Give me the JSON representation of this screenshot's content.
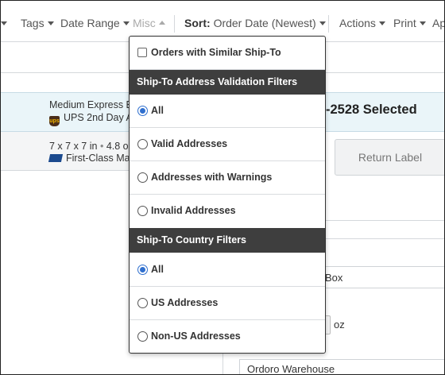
{
  "toolbar": {
    "tags_label": "Tags",
    "date_range_label": "Date Range",
    "misc_label": "Misc",
    "sort_label": "Sort:",
    "sort_value": "Order Date (Newest)",
    "actions_label": "Actions",
    "print_label": "Print",
    "partial_label": "Ap"
  },
  "background": {
    "row1_line1": "Medium Express B",
    "row1_line2": "UPS 2nd Day A",
    "row2_line1": "7 x 7 x 7 in",
    "row2_line1_weight": "4.8 oz",
    "row2_line2": "First-Class Ma",
    "selected_title": "-2528 Selected",
    "return_label_button": "Return Label",
    "box_value": "Box",
    "oz_label": "oz",
    "warehouse_value": "Ordoro Warehouse"
  },
  "dropdown": {
    "similar_shipto_label": "Orders with Similar Ship-To",
    "address_header": "Ship-To Address Validation Filters",
    "address_options": [
      {
        "label": "All",
        "checked": true
      },
      {
        "label": "Valid Addresses",
        "checked": false
      },
      {
        "label": "Addresses with Warnings",
        "checked": false
      },
      {
        "label": "Invalid Addresses",
        "checked": false
      }
    ],
    "country_header": "Ship-To Country Filters",
    "country_options": [
      {
        "label": "All",
        "checked": true
      },
      {
        "label": "US Addresses",
        "checked": false
      },
      {
        "label": "Non-US Addresses",
        "checked": false
      }
    ]
  },
  "colors": {
    "accent": "#2f6fce",
    "header_bg": "#3e3e3e",
    "selected_row_bg": "#eaf5f9"
  }
}
